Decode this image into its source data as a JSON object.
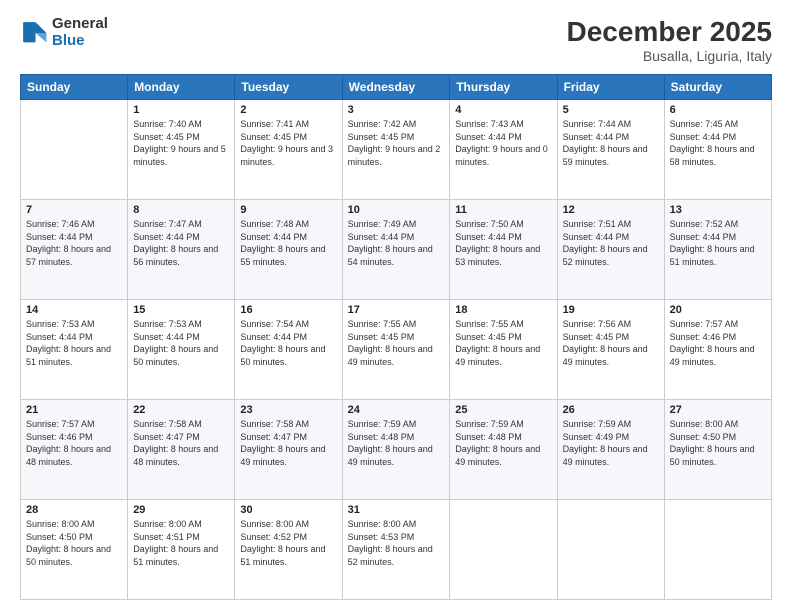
{
  "header": {
    "logo": {
      "general": "General",
      "blue": "Blue"
    },
    "title": "December 2025",
    "location": "Busalla, Liguria, Italy"
  },
  "weekdays": [
    "Sunday",
    "Monday",
    "Tuesday",
    "Wednesday",
    "Thursday",
    "Friday",
    "Saturday"
  ],
  "weeks": [
    [
      {
        "day": "",
        "sunrise": "",
        "sunset": "",
        "daylight": ""
      },
      {
        "day": "1",
        "sunrise": "Sunrise: 7:40 AM",
        "sunset": "Sunset: 4:45 PM",
        "daylight": "Daylight: 9 hours and 5 minutes."
      },
      {
        "day": "2",
        "sunrise": "Sunrise: 7:41 AM",
        "sunset": "Sunset: 4:45 PM",
        "daylight": "Daylight: 9 hours and 3 minutes."
      },
      {
        "day": "3",
        "sunrise": "Sunrise: 7:42 AM",
        "sunset": "Sunset: 4:45 PM",
        "daylight": "Daylight: 9 hours and 2 minutes."
      },
      {
        "day": "4",
        "sunrise": "Sunrise: 7:43 AM",
        "sunset": "Sunset: 4:44 PM",
        "daylight": "Daylight: 9 hours and 0 minutes."
      },
      {
        "day": "5",
        "sunrise": "Sunrise: 7:44 AM",
        "sunset": "Sunset: 4:44 PM",
        "daylight": "Daylight: 8 hours and 59 minutes."
      },
      {
        "day": "6",
        "sunrise": "Sunrise: 7:45 AM",
        "sunset": "Sunset: 4:44 PM",
        "daylight": "Daylight: 8 hours and 58 minutes."
      }
    ],
    [
      {
        "day": "7",
        "sunrise": "Sunrise: 7:46 AM",
        "sunset": "Sunset: 4:44 PM",
        "daylight": "Daylight: 8 hours and 57 minutes."
      },
      {
        "day": "8",
        "sunrise": "Sunrise: 7:47 AM",
        "sunset": "Sunset: 4:44 PM",
        "daylight": "Daylight: 8 hours and 56 minutes."
      },
      {
        "day": "9",
        "sunrise": "Sunrise: 7:48 AM",
        "sunset": "Sunset: 4:44 PM",
        "daylight": "Daylight: 8 hours and 55 minutes."
      },
      {
        "day": "10",
        "sunrise": "Sunrise: 7:49 AM",
        "sunset": "Sunset: 4:44 PM",
        "daylight": "Daylight: 8 hours and 54 minutes."
      },
      {
        "day": "11",
        "sunrise": "Sunrise: 7:50 AM",
        "sunset": "Sunset: 4:44 PM",
        "daylight": "Daylight: 8 hours and 53 minutes."
      },
      {
        "day": "12",
        "sunrise": "Sunrise: 7:51 AM",
        "sunset": "Sunset: 4:44 PM",
        "daylight": "Daylight: 8 hours and 52 minutes."
      },
      {
        "day": "13",
        "sunrise": "Sunrise: 7:52 AM",
        "sunset": "Sunset: 4:44 PM",
        "daylight": "Daylight: 8 hours and 51 minutes."
      }
    ],
    [
      {
        "day": "14",
        "sunrise": "Sunrise: 7:53 AM",
        "sunset": "Sunset: 4:44 PM",
        "daylight": "Daylight: 8 hours and 51 minutes."
      },
      {
        "day": "15",
        "sunrise": "Sunrise: 7:53 AM",
        "sunset": "Sunset: 4:44 PM",
        "daylight": "Daylight: 8 hours and 50 minutes."
      },
      {
        "day": "16",
        "sunrise": "Sunrise: 7:54 AM",
        "sunset": "Sunset: 4:44 PM",
        "daylight": "Daylight: 8 hours and 50 minutes."
      },
      {
        "day": "17",
        "sunrise": "Sunrise: 7:55 AM",
        "sunset": "Sunset: 4:45 PM",
        "daylight": "Daylight: 8 hours and 49 minutes."
      },
      {
        "day": "18",
        "sunrise": "Sunrise: 7:55 AM",
        "sunset": "Sunset: 4:45 PM",
        "daylight": "Daylight: 8 hours and 49 minutes."
      },
      {
        "day": "19",
        "sunrise": "Sunrise: 7:56 AM",
        "sunset": "Sunset: 4:45 PM",
        "daylight": "Daylight: 8 hours and 49 minutes."
      },
      {
        "day": "20",
        "sunrise": "Sunrise: 7:57 AM",
        "sunset": "Sunset: 4:46 PM",
        "daylight": "Daylight: 8 hours and 49 minutes."
      }
    ],
    [
      {
        "day": "21",
        "sunrise": "Sunrise: 7:57 AM",
        "sunset": "Sunset: 4:46 PM",
        "daylight": "Daylight: 8 hours and 48 minutes."
      },
      {
        "day": "22",
        "sunrise": "Sunrise: 7:58 AM",
        "sunset": "Sunset: 4:47 PM",
        "daylight": "Daylight: 8 hours and 48 minutes."
      },
      {
        "day": "23",
        "sunrise": "Sunrise: 7:58 AM",
        "sunset": "Sunset: 4:47 PM",
        "daylight": "Daylight: 8 hours and 49 minutes."
      },
      {
        "day": "24",
        "sunrise": "Sunrise: 7:59 AM",
        "sunset": "Sunset: 4:48 PM",
        "daylight": "Daylight: 8 hours and 49 minutes."
      },
      {
        "day": "25",
        "sunrise": "Sunrise: 7:59 AM",
        "sunset": "Sunset: 4:48 PM",
        "daylight": "Daylight: 8 hours and 49 minutes."
      },
      {
        "day": "26",
        "sunrise": "Sunrise: 7:59 AM",
        "sunset": "Sunset: 4:49 PM",
        "daylight": "Daylight: 8 hours and 49 minutes."
      },
      {
        "day": "27",
        "sunrise": "Sunrise: 8:00 AM",
        "sunset": "Sunset: 4:50 PM",
        "daylight": "Daylight: 8 hours and 50 minutes."
      }
    ],
    [
      {
        "day": "28",
        "sunrise": "Sunrise: 8:00 AM",
        "sunset": "Sunset: 4:50 PM",
        "daylight": "Daylight: 8 hours and 50 minutes."
      },
      {
        "day": "29",
        "sunrise": "Sunrise: 8:00 AM",
        "sunset": "Sunset: 4:51 PM",
        "daylight": "Daylight: 8 hours and 51 minutes."
      },
      {
        "day": "30",
        "sunrise": "Sunrise: 8:00 AM",
        "sunset": "Sunset: 4:52 PM",
        "daylight": "Daylight: 8 hours and 51 minutes."
      },
      {
        "day": "31",
        "sunrise": "Sunrise: 8:00 AM",
        "sunset": "Sunset: 4:53 PM",
        "daylight": "Daylight: 8 hours and 52 minutes."
      },
      {
        "day": "",
        "sunrise": "",
        "sunset": "",
        "daylight": ""
      },
      {
        "day": "",
        "sunrise": "",
        "sunset": "",
        "daylight": ""
      },
      {
        "day": "",
        "sunrise": "",
        "sunset": "",
        "daylight": ""
      }
    ]
  ]
}
